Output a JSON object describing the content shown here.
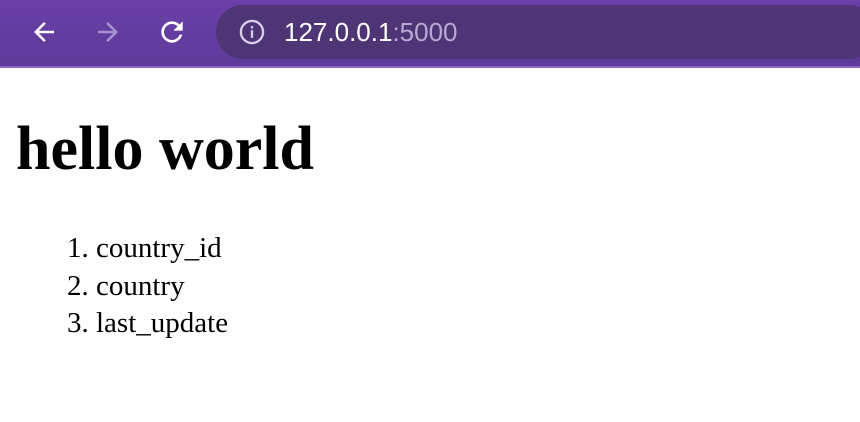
{
  "browser": {
    "url_host": "127.0.0.1",
    "url_port": ":5000",
    "icons": {
      "back": "arrow-left-icon",
      "forward": "arrow-right-icon",
      "reload": "reload-icon",
      "site_info": "info-circle-icon"
    },
    "colors": {
      "toolbar": "#6a3fa8",
      "omnibox": "#4e3576",
      "icon_active": "#ffffff",
      "icon_disabled": "#a890d0"
    }
  },
  "page": {
    "heading": "hello world",
    "items": [
      {
        "label": "country_id"
      },
      {
        "label": "country"
      },
      {
        "label": "last_update"
      }
    ]
  }
}
